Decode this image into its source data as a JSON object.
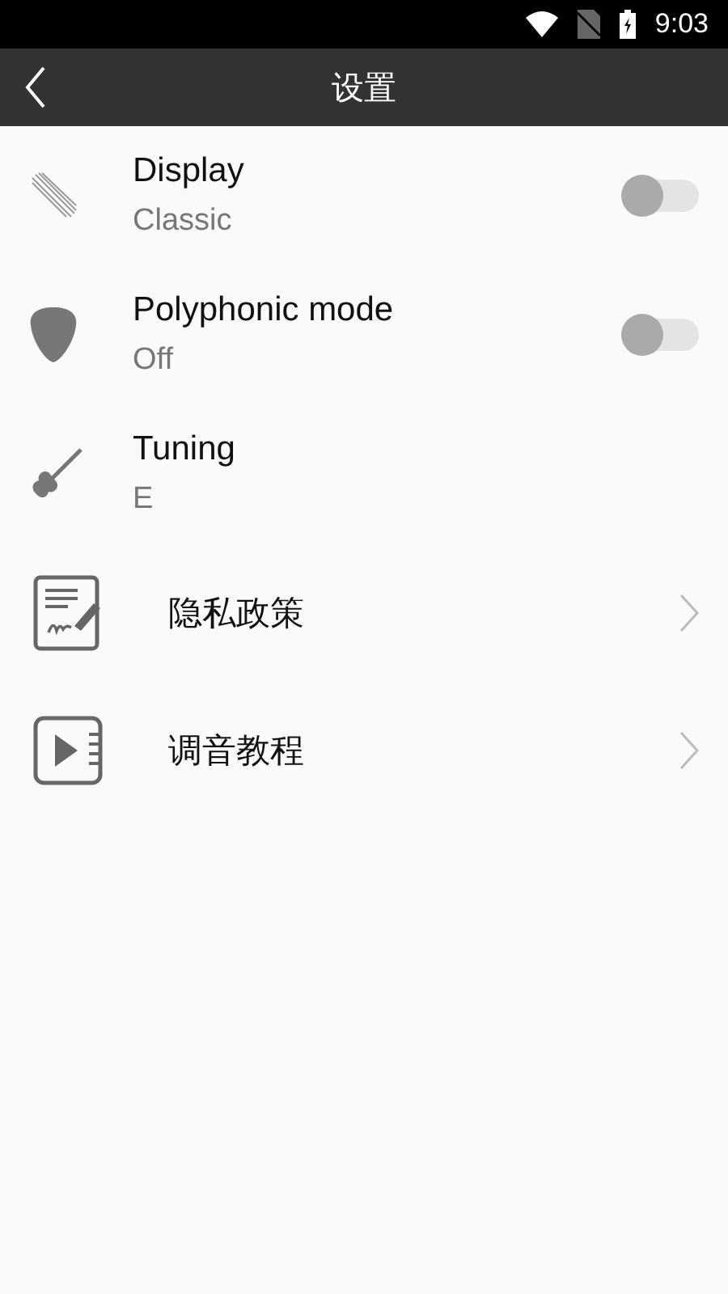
{
  "status_bar": {
    "time": "9:03"
  },
  "header": {
    "title": "设置"
  },
  "settings": [
    {
      "kind": "toggle",
      "title": "Display",
      "value": "Classic",
      "on": false
    },
    {
      "kind": "toggle",
      "title": "Polyphonic mode",
      "value": "Off",
      "on": false
    },
    {
      "kind": "value",
      "title": "Tuning",
      "value": "E"
    },
    {
      "kind": "link",
      "title": "隐私政策"
    },
    {
      "kind": "link",
      "title": "调音教程"
    }
  ]
}
